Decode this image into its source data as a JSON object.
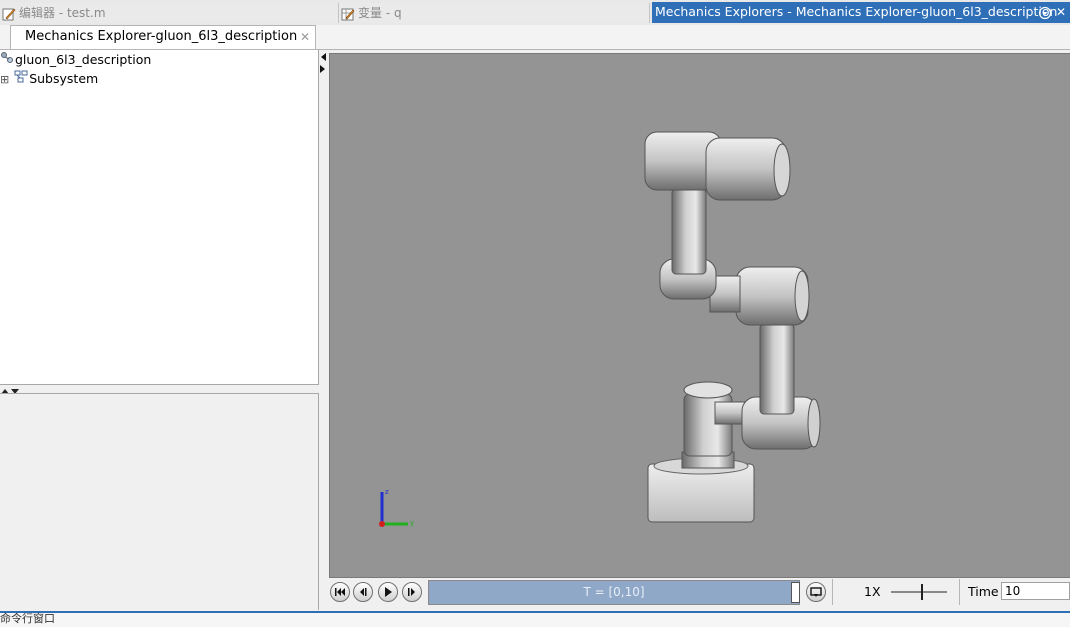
{
  "top_tabs": [
    {
      "label": "编辑器 - test.m",
      "icon": "editor-icon"
    },
    {
      "label": "变量 - q",
      "icon": "variable-icon"
    }
  ],
  "active_window": {
    "title": "Mechanics Explorers - Mechanics Explorer-gluon_6l3_description",
    "menu_icon": "dropdown-circle-icon",
    "close_icon": "close-icon"
  },
  "sub_tab": {
    "label": "Mechanics Explorer-gluon_6l3_description",
    "close": "✕"
  },
  "tree": {
    "root": {
      "label": "gluon_6l3_description",
      "icon": "model-icon"
    },
    "children": [
      {
        "label": "Subsystem",
        "icon": "subsystem-icon",
        "expand": "⊞"
      }
    ]
  },
  "playback": {
    "buttons": [
      "skip-to-start-icon",
      "step-back-icon",
      "play-icon",
      "step-forward-icon"
    ],
    "time_range": "T = [0,10]",
    "speed": "1X",
    "time_label": "Time",
    "time_value": "10",
    "loop_icon": "loop-icon"
  },
  "command_window": {
    "label": "命令行窗口"
  },
  "colors": {
    "active_tab": "#2f6fb7",
    "viewport_bg": "#949494",
    "timeline": "#8fa8c8"
  }
}
